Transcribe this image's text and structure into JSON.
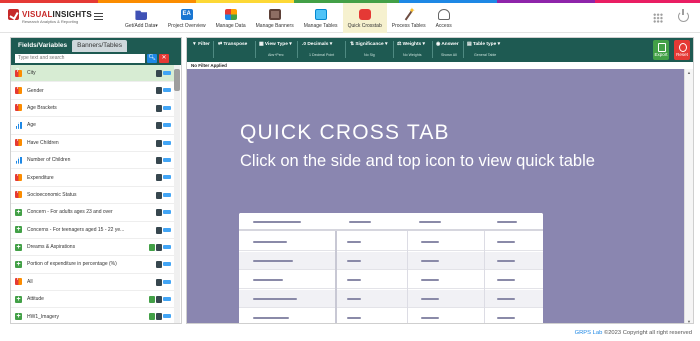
{
  "header": {
    "logo_prefix": "VISUAL",
    "logo_suffix": "INSIGHTS",
    "logo_sub": "Research Analytics & Reporting",
    "nav": [
      {
        "label": "Get/Add Data▾",
        "icon": "folder-icon"
      },
      {
        "label": "Project Overview",
        "icon": "ea-icon"
      },
      {
        "label": "Manage Data",
        "icon": "data-icon"
      },
      {
        "label": "Manage Banners",
        "icon": "banner-icon"
      },
      {
        "label": "Manage Tables",
        "icon": "tables-icon"
      },
      {
        "label": "Quick Crosstab",
        "icon": "crosstab-icon",
        "active": true
      },
      {
        "label": "Process Tables",
        "icon": "wand-icon"
      },
      {
        "label": "Access",
        "icon": "access-icon"
      }
    ]
  },
  "left_panel": {
    "tabs": [
      "Fields/Variables",
      "Banners/Tables"
    ],
    "search_placeholder": "Type text and search",
    "variables": [
      {
        "label": "City",
        "type": "categorical",
        "selected": true
      },
      {
        "label": "Gender",
        "type": "categorical"
      },
      {
        "label": "Age Brackets",
        "type": "categorical"
      },
      {
        "label": "Age",
        "type": "numeric"
      },
      {
        "label": "Have Children",
        "type": "categorical"
      },
      {
        "label": "Number of Children",
        "type": "numeric"
      },
      {
        "label": "Expenditure",
        "type": "categorical"
      },
      {
        "label": "Socioeconomic Status",
        "type": "categorical"
      },
      {
        "label": "Concern - For adults ages 23 and over",
        "type": "group"
      },
      {
        "label": "Concerns - For teenagers aged 15 - 22 ye...",
        "type": "group"
      },
      {
        "label": "Dreams & Aspirations",
        "type": "group",
        "extra": true
      },
      {
        "label": "Portion of expenditure in percentage (%)",
        "type": "group"
      },
      {
        "label": "All",
        "type": "categorical"
      },
      {
        "label": "Attitude",
        "type": "group",
        "extra": true
      },
      {
        "label": "HW1_Imagery",
        "type": "group",
        "extra": true
      }
    ]
  },
  "toolbar": {
    "items": [
      {
        "label": "Filter",
        "sub": ""
      },
      {
        "label": "Transpose",
        "sub": ""
      },
      {
        "label": "View Type ▾",
        "sub": "Abs+Perc"
      },
      {
        "label": "Decimals ▾",
        "sub": "1 Decimal Point"
      },
      {
        "label": "Significance ▾",
        "sub": "No Sig"
      },
      {
        "label": "Weights ▾",
        "sub": "No Weights"
      },
      {
        "label": "Answer",
        "sub": "Shown All"
      },
      {
        "label": "Table type ▾",
        "sub": "General Table"
      }
    ],
    "export_label": "Export",
    "reset_label": "Reset"
  },
  "filter_status": "No Filter Applied",
  "hero": {
    "title": "QUICK CROSS TAB",
    "subtitle": "Click on the side and top icon to view quick table"
  },
  "footer": {
    "brand": "GRPS Lab",
    "copyright": "©2023 Copyright all right reserved"
  }
}
